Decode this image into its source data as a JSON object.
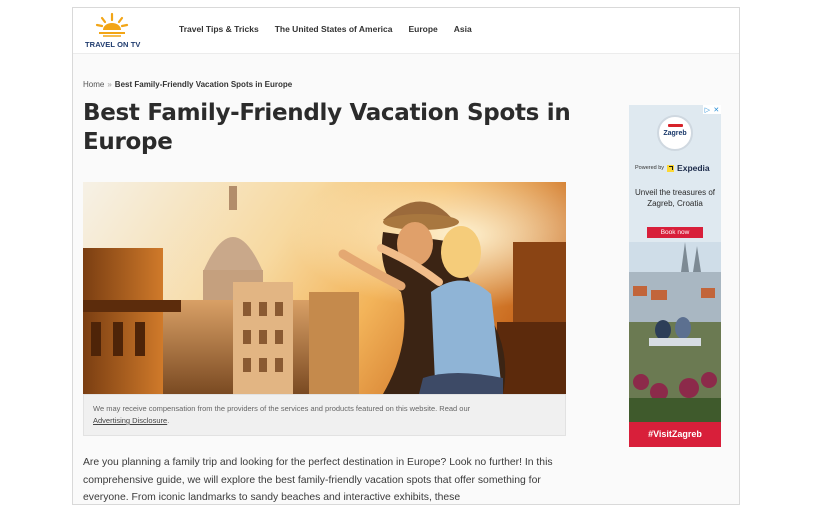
{
  "site": {
    "logo_text": "TRAVEL ON TV",
    "nav": [
      {
        "label": "Travel Tips & Tricks"
      },
      {
        "label": "The United States of America"
      },
      {
        "label": "Europe"
      },
      {
        "label": "Asia"
      }
    ]
  },
  "breadcrumb": {
    "home": "Home",
    "separator": "»",
    "current": "Best Family-Friendly Vacation Spots in Europe"
  },
  "article": {
    "title": "Best Family-Friendly Vacation Spots in Europe",
    "disclosure_text": "We may receive compensation from the providers of the services and products featured on this website. Read our",
    "disclosure_link": "Advertising Disclosure",
    "disclosure_end": ".",
    "intro": "Are you planning a family trip and looking for the perfect destination in Europe? Look no further! In this comprehensive guide, we will explore the best family-friendly vacation spots that offer something for everyone. From iconic landmarks to sandy beaches and interactive exhibits, these"
  },
  "ad": {
    "badge_name": "Zagreb",
    "powered_by": "Powered by",
    "partner": "Expedia",
    "headline": "Unveil the treasures of Zagreb, Croatia",
    "cta": "Book now",
    "hashtag": "#VisitZagreb",
    "accent_color": "#d81f3a"
  }
}
